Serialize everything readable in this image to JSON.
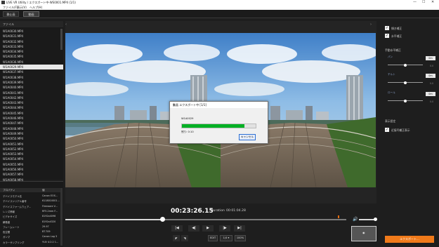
{
  "window": {
    "title": "LIVE VR Utility / エクスポート中-WS0001.MP4 (1/1)",
    "controls": [
      "—",
      "☐",
      "✕"
    ]
  },
  "menu": [
    "ファイル(F)",
    "表示(V)",
    "ヘルプ(H)"
  ],
  "tabs": [
    {
      "label": "静止画",
      "active": false
    },
    {
      "label": "動画",
      "active": true
    }
  ],
  "files": {
    "header": "ファイル",
    "items": [
      {
        "name": "W1A0030.MP4",
        "selected": false
      },
      {
        "name": "W1A0031.MP4",
        "selected": false
      },
      {
        "name": "W1A0032.MP4",
        "selected": false
      },
      {
        "name": "W1A0033.MP4",
        "selected": false
      },
      {
        "name": "W1A0034.MP4",
        "selected": false
      },
      {
        "name": "W1A0035.MP4",
        "selected": false
      },
      {
        "name": "W1A0036.MP4",
        "selected": false
      },
      {
        "name": "W1A0029.MP4",
        "selected": true
      },
      {
        "name": "W1A0037.MP4",
        "selected": false
      },
      {
        "name": "W1A0038.MP4",
        "selected": false
      },
      {
        "name": "W1A0039.MP4",
        "selected": false
      },
      {
        "name": "W1A0040.MP4",
        "selected": false
      },
      {
        "name": "W1A0041.MP4",
        "selected": false
      },
      {
        "name": "W1A0042.MP4",
        "selected": false
      },
      {
        "name": "W1A0043.MP4",
        "selected": false
      },
      {
        "name": "W1A0044.MP4",
        "selected": false
      },
      {
        "name": "W1A0045.MP4",
        "selected": false
      },
      {
        "name": "W1A0046.MP4",
        "selected": false
      },
      {
        "name": "W1A0047.MP4",
        "selected": false
      },
      {
        "name": "W1A0048.MP4",
        "selected": false
      },
      {
        "name": "W1A0049.MP4",
        "selected": false
      },
      {
        "name": "W1A0050.MP4",
        "selected": false
      },
      {
        "name": "W1A0051.MP4",
        "selected": false
      },
      {
        "name": "W1A0052.MP4",
        "selected": false
      },
      {
        "name": "W1A0053.MP4",
        "selected": false
      },
      {
        "name": "W1A0054.MP4",
        "selected": false
      },
      {
        "name": "W1A0055.MP4",
        "selected": false
      },
      {
        "name": "W1A0056.MP4",
        "selected": false
      },
      {
        "name": "W1A0057.MP4",
        "selected": false
      },
      {
        "name": "W1A0058.MP4",
        "selected": false
      }
    ]
  },
  "properties": {
    "col_name": "プロパティ",
    "col_value": "値",
    "rows": [
      {
        "name": "デバイスモデル名",
        "value": "Canon EOS..."
      },
      {
        "name": "デバイスシリアル番号",
        "value": "6118010001..."
      },
      {
        "name": "デバイスファームウェア...",
        "value": "Firmware V..."
      },
      {
        "name": "レンズ情報",
        "value": "RF5.2mm F..."
      },
      {
        "name": "ビデオサイズ",
        "value": "8192x4096"
      },
      {
        "name": "解像度",
        "value": "8192x4320"
      },
      {
        "name": "フレームレート",
        "value": "29.97"
      },
      {
        "name": "色空間",
        "value": "BT.709"
      },
      {
        "name": "ガンマ",
        "value": "Canon Log 3"
      },
      {
        "name": "カラーサンプリング",
        "value": "YUV 4:2:2 1..."
      }
    ]
  },
  "viewer": {
    "nav_left": "‹",
    "nav_right": "›"
  },
  "dialog": {
    "title": "動画 エクスポート中 [1/1]",
    "close": "✕",
    "filename": "W1A0029",
    "progress": 0.85,
    "remaining": "残り: 0:10",
    "cancel_label": "キャンセル"
  },
  "transport": {
    "timecode": "00:23:26.15",
    "duration_label": "Duration",
    "duration_value": "00:01:04.28",
    "position_fraction": 0.35,
    "volume_icon": "🔊",
    "buttons": [
      "|◀",
      "◀|",
      "▶",
      "|▶",
      "▶|"
    ],
    "in_mark": "◤",
    "out_mark": "◥",
    "edit_label": "EDIT",
    "speed": "1/4 ▾",
    "zoom": "100%",
    "preview_label": "◉"
  },
  "settings": {
    "checkboxes": [
      {
        "label": "傾き補正",
        "checked": true
      },
      {
        "label": "水平補正",
        "checked": true
      }
    ],
    "adjust_header": "手動水平補正",
    "sliders": [
      {
        "label": "パン",
        "value": "0m",
        "reset": "0.0"
      },
      {
        "label": "チルト",
        "value": "0m",
        "reset": "0.0"
      },
      {
        "label": "ロール",
        "value": "0m",
        "reset": "0.0"
      }
    ],
    "display_header": "表示設定",
    "display_checkbox": {
      "label": "近接円補正表示",
      "checked": true
    },
    "export_label": "エクスポート..."
  },
  "colors": {
    "accent": "#f07a1a",
    "progress": "#06b025",
    "selected_row": "#e8e8e8"
  }
}
